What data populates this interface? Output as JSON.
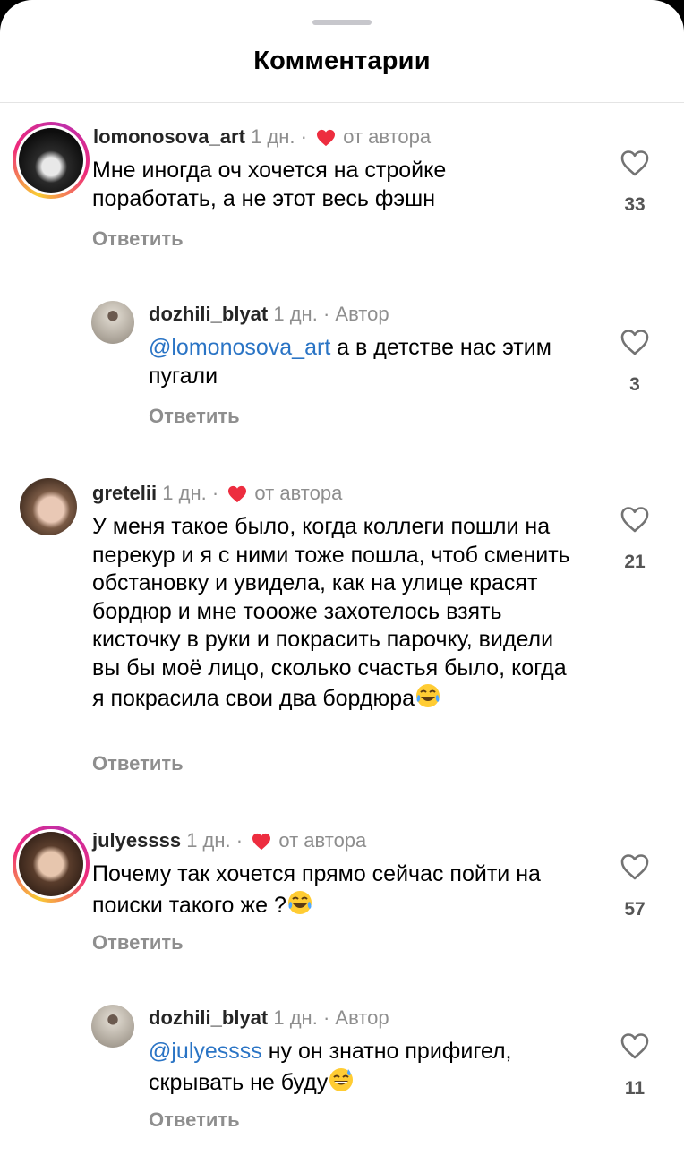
{
  "header": {
    "title": "Комментарии"
  },
  "comments": [
    {
      "username": "lomonosova_art",
      "time": "1 дн.",
      "separator": "·",
      "author_badge": "от автора",
      "text": "Мне иногда оч хочется на стройке поработать, а не этот весь фэшн",
      "reply_label": "Ответить",
      "likes": "33"
    },
    {
      "username": "dozhili_blyat",
      "time": "1 дн.",
      "separator": "·",
      "author_badge": "Автор",
      "mention": "@lomonosova_art",
      "text": " а в детстве нас этим пугали",
      "reply_label": "Ответить",
      "likes": "3"
    },
    {
      "username": "gretelii",
      "time": "1 дн.",
      "separator": "·",
      "author_badge": "от автора",
      "text": "У меня такое было, когда коллеги пошли на перекур и я с ними тоже пошла, чтоб сменить обстановку и увидела, как на улице красят бордюр и мне тоооже захотелось взять кисточку в руки и покрасить парочку, видели вы бы моё лицо, сколько счастья было, когда я покрасила свои два бордюра",
      "emoji": "face-with-tears-of-joy",
      "reply_label": "Ответить",
      "likes": "21"
    },
    {
      "username": "julyessss",
      "time": "1 дн.",
      "separator": "·",
      "author_badge": "от автора",
      "text": "Почему так хочется прямо сейчас пойти на поиски такого же ?",
      "emoji": "face-with-tears-of-joy",
      "reply_label": "Ответить",
      "likes": "57"
    },
    {
      "username": "dozhili_blyat",
      "time": "1 дн.",
      "separator": "·",
      "author_badge": "Автор",
      "mention": "@julyessss",
      "text": " ну он знатно прифигел, скрывать не буду",
      "emoji": "grinning-face-with-sweat",
      "reply_label": "Ответить",
      "likes": "11"
    }
  ],
  "colors": {
    "heart_red": "#ed2d3f",
    "mention_blue": "#2a74c5",
    "meta_gray": "#8e8e8e"
  }
}
